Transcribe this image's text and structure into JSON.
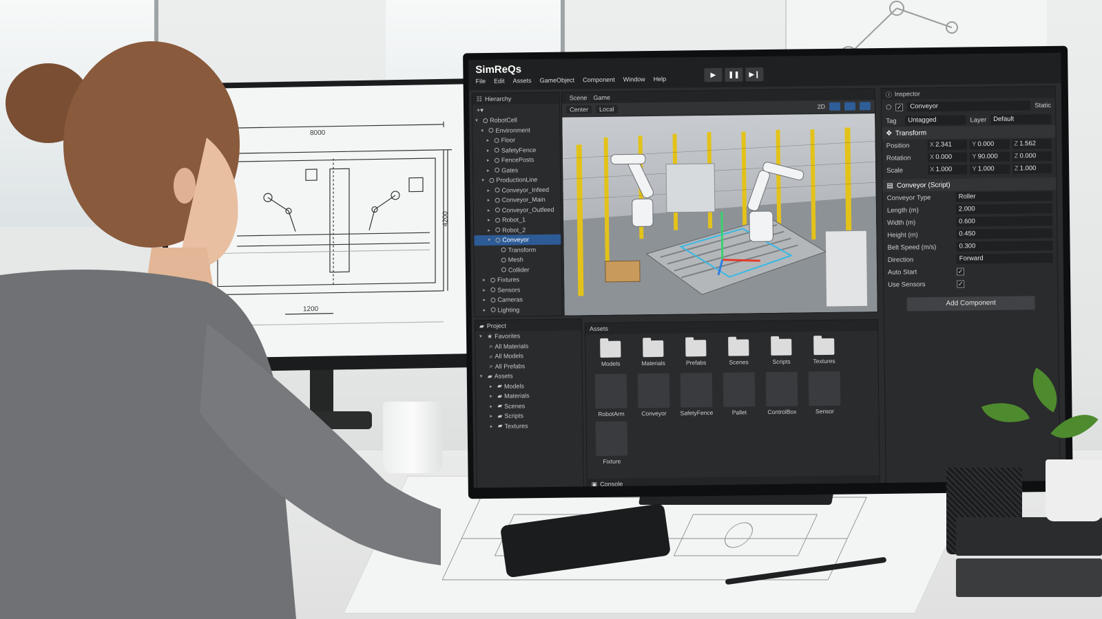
{
  "app": {
    "title": "SimReQs",
    "menu": [
      "File",
      "Edit",
      "Assets",
      "GameObject",
      "Component",
      "Window",
      "Help"
    ]
  },
  "playback": {
    "play_icon": "play-icon",
    "pause_icon": "pause-icon",
    "step_icon": "step-icon"
  },
  "hierarchy": {
    "header": "Hierarchy",
    "items": [
      {
        "label": "RobotCell",
        "depth": 0,
        "expanded": true
      },
      {
        "label": "Environment",
        "depth": 1,
        "expanded": true
      },
      {
        "label": "Floor",
        "depth": 2
      },
      {
        "label": "SafetyFence",
        "depth": 2
      },
      {
        "label": "FencePosts",
        "depth": 2
      },
      {
        "label": "Gates",
        "depth": 2
      },
      {
        "label": "ProductionLine",
        "depth": 1,
        "expanded": true
      },
      {
        "label": "Conveyor_Infeed",
        "depth": 2
      },
      {
        "label": "Conveyor_Main",
        "depth": 2
      },
      {
        "label": "Conveyor_Outfeed",
        "depth": 2
      },
      {
        "label": "Robot_1",
        "depth": 2
      },
      {
        "label": "Robot_2",
        "depth": 2
      },
      {
        "label": "Conveyor",
        "depth": 2,
        "selected": true,
        "expanded": true
      },
      {
        "label": "Transform",
        "depth": 3
      },
      {
        "label": "Mesh",
        "depth": 3
      },
      {
        "label": "Collider",
        "depth": 3
      },
      {
        "label": "Fixtures",
        "depth": 1
      },
      {
        "label": "Sensors",
        "depth": 1
      },
      {
        "label": "Cameras",
        "depth": 1
      },
      {
        "label": "Lighting",
        "depth": 1
      }
    ]
  },
  "scene": {
    "tabs": [
      "Scene",
      "Game"
    ],
    "toolbar": {
      "pivot": "Center",
      "space": "Local",
      "mode": "2D"
    }
  },
  "project": {
    "header": "Project",
    "favorites_label": "Favorites",
    "favorites": [
      "All Materials",
      "All Models",
      "All Prefabs"
    ],
    "assets_label": "Assets",
    "folders": [
      "Models",
      "Materials",
      "Scenes",
      "Scripts",
      "Textures"
    ]
  },
  "assets_panel": {
    "header": "Assets",
    "folders": [
      "Models",
      "Materials",
      "Prefabs",
      "Scenes",
      "Scripts",
      "Textures"
    ],
    "prefabs": [
      "RobotArm",
      "Conveyor",
      "SafetyFence",
      "Pallet",
      "ControlBox",
      "Sensor",
      "Fixture"
    ],
    "console_label": "Console"
  },
  "inspector": {
    "header": "Inspector",
    "object_name": "Conveyor",
    "static_label": "Static",
    "tag_label": "Tag",
    "tag_value": "Untagged",
    "layer_label": "Layer",
    "layer_value": "Default",
    "transform": {
      "title": "Transform",
      "position_label": "Position",
      "position": {
        "x": "2.341",
        "y": "0.000",
        "z": "1.562"
      },
      "rotation_label": "Rotation",
      "rotation": {
        "x": "0.000",
        "y": "90.000",
        "z": "0.000"
      },
      "scale_label": "Scale",
      "scale": {
        "x": "1.000",
        "y": "1.000",
        "z": "1.000"
      }
    },
    "script": {
      "title": "Conveyor (Script)",
      "fields": [
        {
          "label": "Conveyor Type",
          "value": "Roller",
          "kind": "dropdown"
        },
        {
          "label": "Length (m)",
          "value": "2.000",
          "kind": "number"
        },
        {
          "label": "Width (m)",
          "value": "0.600",
          "kind": "number"
        },
        {
          "label": "Height (m)",
          "value": "0.450",
          "kind": "number"
        },
        {
          "label": "Belt Speed (m/s)",
          "value": "0.300",
          "kind": "number"
        },
        {
          "label": "Direction",
          "value": "Forward",
          "kind": "dropdown"
        },
        {
          "label": "Auto Start",
          "checked": true,
          "kind": "checkbox"
        },
        {
          "label": "Use Sensors",
          "checked": true,
          "kind": "checkbox"
        }
      ]
    },
    "add_component": "Add Component"
  },
  "cad": {
    "dim_top": "8000",
    "dim_right": "4200",
    "dim_bottom": "1200"
  },
  "colors": {
    "selection": "#2d5b96",
    "panel": "#2a2b2d",
    "fence_yellow": "#e3c21a",
    "gizmo_green": "#3bd16f",
    "gizmo_red": "#e23a2c",
    "gizmo_blue": "#2e7de0"
  }
}
